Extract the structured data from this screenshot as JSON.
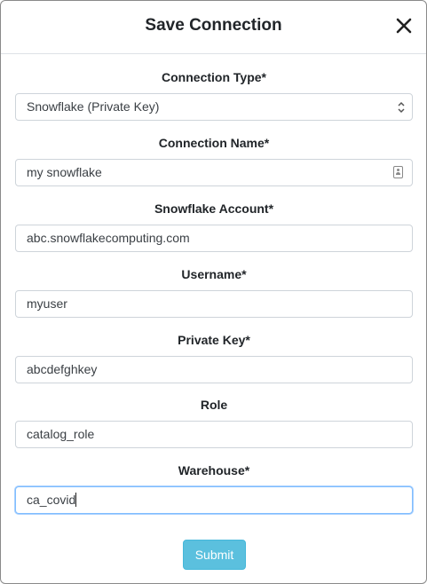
{
  "dialog": {
    "title": "Save Connection",
    "close_icon": "close-icon"
  },
  "fields": [
    {
      "label": "Connection Type*",
      "value": "Snowflake (Private Key)",
      "kind": "select"
    },
    {
      "label": "Connection Name*",
      "value": "my snowflake",
      "kind": "text"
    },
    {
      "label": "Snowflake Account*",
      "value": "abc.snowflakecomputing.com",
      "kind": "text"
    },
    {
      "label": "Username*",
      "value": "myuser",
      "kind": "text"
    },
    {
      "label": "Private Key*",
      "value": "abcdefghkey",
      "kind": "text"
    },
    {
      "label": "Role",
      "value": "catalog_role",
      "kind": "text"
    },
    {
      "label": "Warehouse*",
      "value": "ca_covid",
      "kind": "text",
      "focused": true
    }
  ],
  "submit_label": "Submit",
  "colors": {
    "submit_bg": "#5bc0de",
    "focus_border": "#80bdff"
  }
}
